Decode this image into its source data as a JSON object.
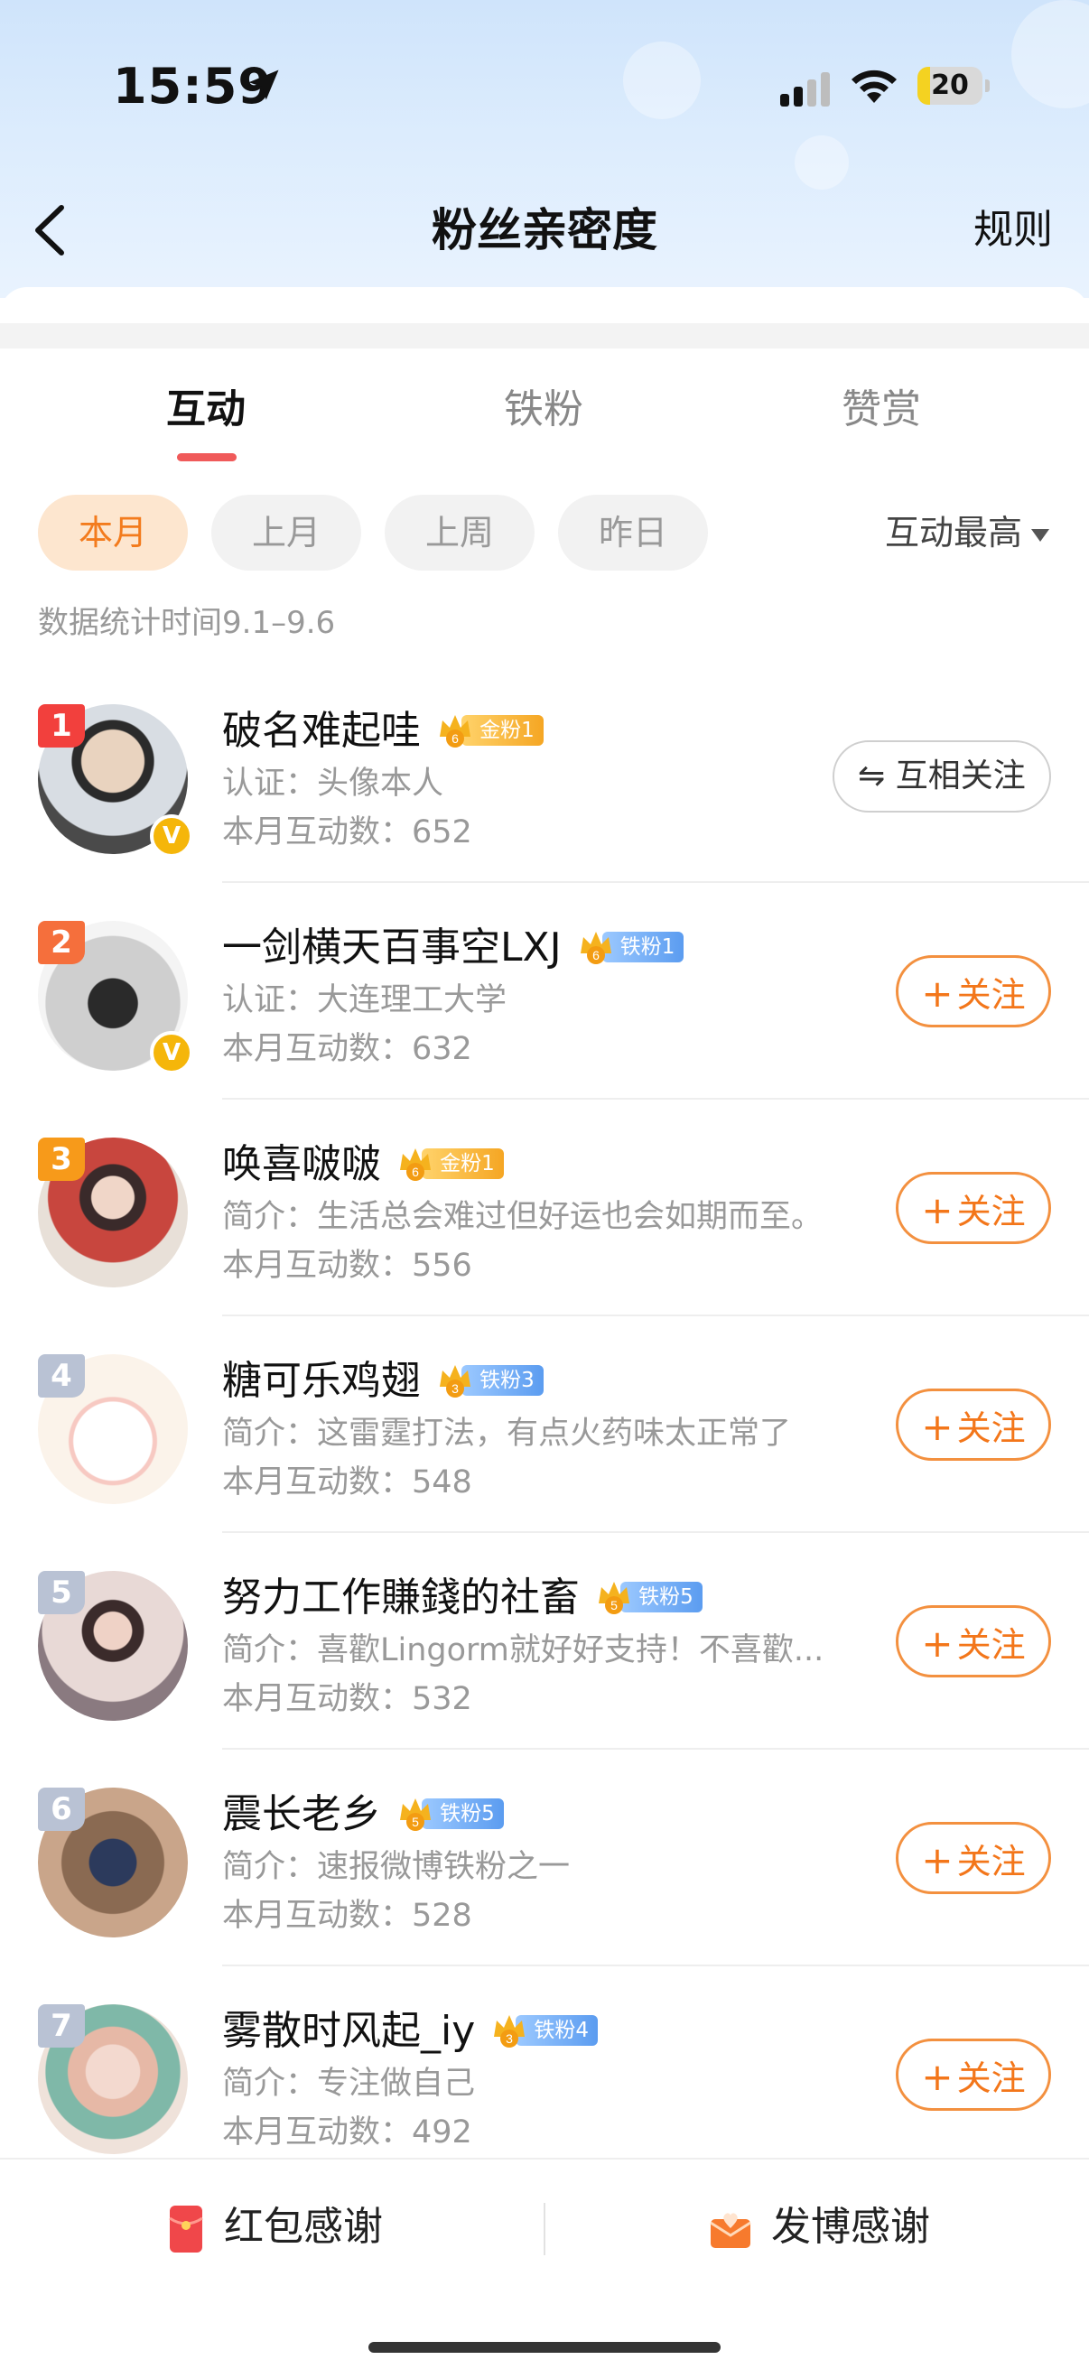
{
  "status_bar": {
    "time": "15:59",
    "battery": "20",
    "battery_level": 0.2
  },
  "nav": {
    "title": "粉丝亲密度",
    "rules": "规则"
  },
  "tabs": [
    {
      "label": "互动",
      "active": true
    },
    {
      "label": "铁粉",
      "active": false
    },
    {
      "label": "赞赏",
      "active": false
    }
  ],
  "filters": {
    "chips": [
      "本月",
      "上月",
      "上周",
      "昨日"
    ],
    "active_index": 0,
    "sort_label": "互动最高"
  },
  "stat_time": "数据统计时间9.1–9.6",
  "rows": [
    {
      "rank": "1",
      "rank_color": "#f2403d",
      "name": "破名难起哇",
      "badge_type": "gold",
      "badge_level": "6",
      "badge_text": "金粉1",
      "sub": "认证：头像本人",
      "count": "本月互动数：652",
      "verified": true,
      "action": "mutual",
      "action_label": "互相关注",
      "action_icon": "⇋"
    },
    {
      "rank": "2",
      "rank_color": "#f56f3c",
      "name": "一剑横天百事空LXJ",
      "badge_type": "iron",
      "badge_level": "6",
      "badge_text": "铁粉1",
      "sub": "认证：大连理工大学",
      "count": "本月互动数：632",
      "verified": true,
      "action": "follow",
      "action_label": "关注",
      "action_icon": "+"
    },
    {
      "rank": "3",
      "rank_color": "#f79a1a",
      "name": "唤喜啵啵",
      "badge_type": "gold",
      "badge_level": "6",
      "badge_text": "金粉1",
      "sub": "简介：生活总会难过但好运也会如期而至。",
      "count": "本月互动数：556",
      "verified": false,
      "action": "follow",
      "action_label": "关注",
      "action_icon": "+"
    },
    {
      "rank": "4",
      "rank_color": "#b9c2d4",
      "name": "糖可乐鸡翅",
      "badge_type": "iron",
      "badge_level": "3",
      "badge_text": "铁粉3",
      "sub": "简介：这雷霆打法，有点火药味太正常了",
      "count": "本月互动数：548",
      "verified": false,
      "action": "follow",
      "action_label": "关注",
      "action_icon": "+"
    },
    {
      "rank": "5",
      "rank_color": "#b9c2d4",
      "name": "努力工作賺錢的社畜",
      "badge_type": "iron",
      "badge_level": "5",
      "badge_text": "铁粉5",
      "sub": "简介：喜歡Lingorm就好好支持！不喜歡...",
      "count": "本月互动数：532",
      "verified": false,
      "action": "follow",
      "action_label": "关注",
      "action_icon": "+"
    },
    {
      "rank": "6",
      "rank_color": "#b9c2d4",
      "name": "震长老乡",
      "badge_type": "iron",
      "badge_level": "5",
      "badge_text": "铁粉5",
      "sub": "简介：速报微博铁粉之一",
      "count": "本月互动数：528",
      "verified": false,
      "action": "follow",
      "action_label": "关注",
      "action_icon": "+"
    },
    {
      "rank": "7",
      "rank_color": "#b9c2d4",
      "name": "雾散时风起_iy",
      "badge_type": "iron",
      "badge_level": "3",
      "badge_text": "铁粉4",
      "sub": "简介：专注做自己",
      "count": "本月互动数：492",
      "verified": false,
      "action": "follow",
      "action_label": "关注",
      "action_icon": "+"
    }
  ],
  "bottom_bar": {
    "redpacket_label": "红包感谢",
    "post_label": "发博感谢"
  },
  "colors": {
    "accent": "#f3761a",
    "tab_underline": "#f05a5a",
    "gold_badge": "#f5a623",
    "iron_badge": "#5b9cf0"
  }
}
